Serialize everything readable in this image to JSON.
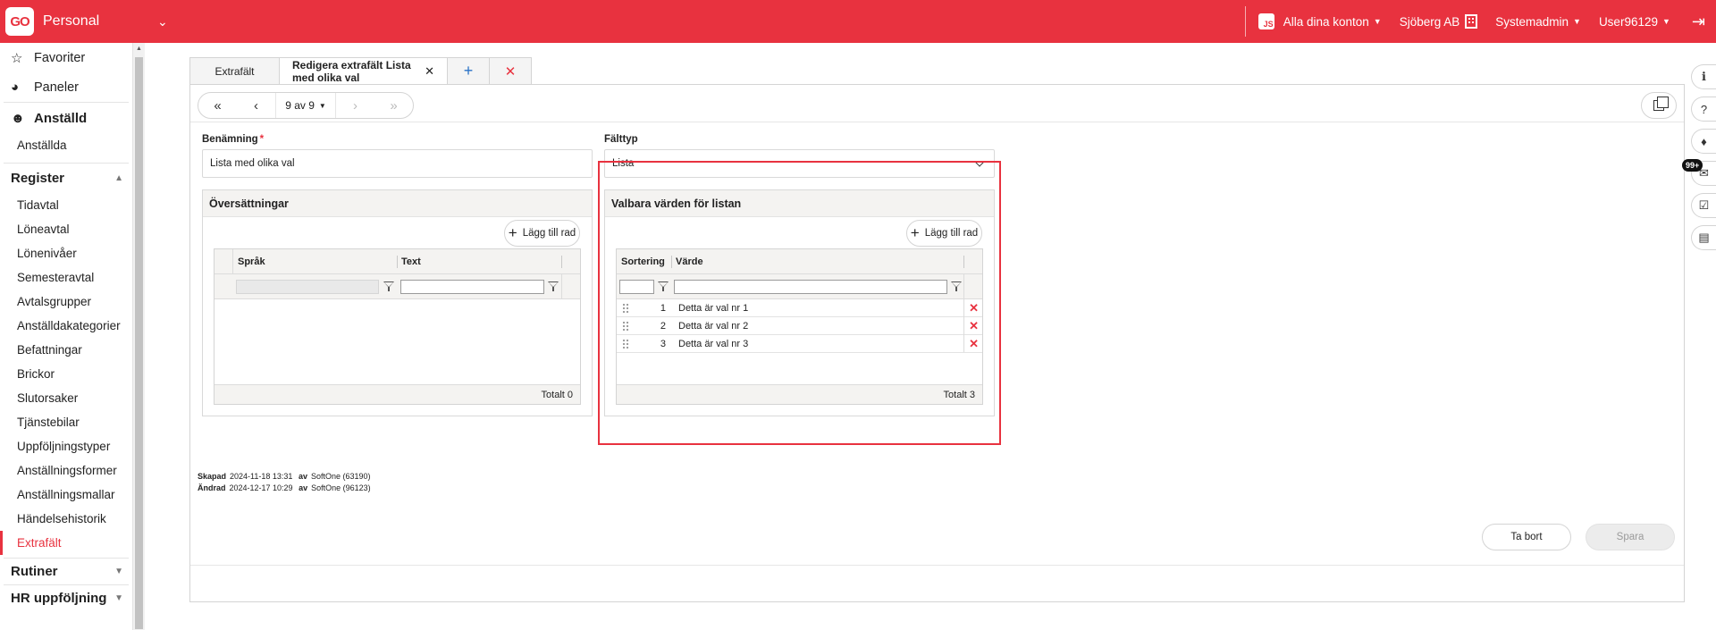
{
  "topbar": {
    "logo": "GO",
    "module": "Personal",
    "account_badge": "JS",
    "accounts": "Alla dina konton",
    "company": "Sjöberg AB",
    "role": "Systemadmin",
    "user": "User96129",
    "brand_color": "#e8323f"
  },
  "sidebar": {
    "favorites": "Favoriter",
    "panels": "Paneler",
    "employee_section": "Anställd",
    "employees": "Anställda",
    "register_section": "Register",
    "register_items": [
      "Tidavtal",
      "Löneavtal",
      "Lönenivåer",
      "Semesteravtal",
      "Avtalsgrupper",
      "Anställdakategorier",
      "Befattningar",
      "Brickor",
      "Slutorsaker",
      "Tjänstebilar",
      "Uppföljningstyper",
      "Anställningsformer",
      "Anställningsmallar",
      "Händelsehistorik",
      "Extrafält"
    ],
    "active_item": "Extrafält",
    "routines_section": "Rutiner",
    "hr_section": "HR uppföljning"
  },
  "tabs": {
    "list": "Extrafält",
    "edit": "Redigera extrafält Lista med olika val"
  },
  "toolbar": {
    "pager": "9 av 9"
  },
  "form": {
    "name_label": "Benämning",
    "required_mark": "*",
    "name_value": "Lista med olika val",
    "type_label": "Fälttyp",
    "type_value": "Lista"
  },
  "translations": {
    "title": "Översättningar",
    "add_row": "Lägg till rad",
    "col_language": "Språk",
    "col_text": "Text",
    "total": "Totalt 0"
  },
  "values": {
    "title": "Valbara värden för listan",
    "add_row": "Lägg till rad",
    "col_sort": "Sortering",
    "col_value": "Värde",
    "rows": [
      {
        "sort": "1",
        "value": "Detta är val nr 1"
      },
      {
        "sort": "2",
        "value": "Detta är val nr 2"
      },
      {
        "sort": "3",
        "value": "Detta är val nr 3"
      }
    ],
    "total": "Totalt 3"
  },
  "meta": {
    "created_label": "Skapad",
    "created_value": "2024-11-18 13:31",
    "created_by_label": "av",
    "created_by": "SoftOne (63190)",
    "modified_label": "Ändrad",
    "modified_value": "2024-12-17 10:29",
    "modified_by_label": "av",
    "modified_by": "SoftOne (96123)"
  },
  "actions": {
    "delete": "Ta bort",
    "save": "Spara"
  },
  "rail": {
    "badge": "99+"
  }
}
